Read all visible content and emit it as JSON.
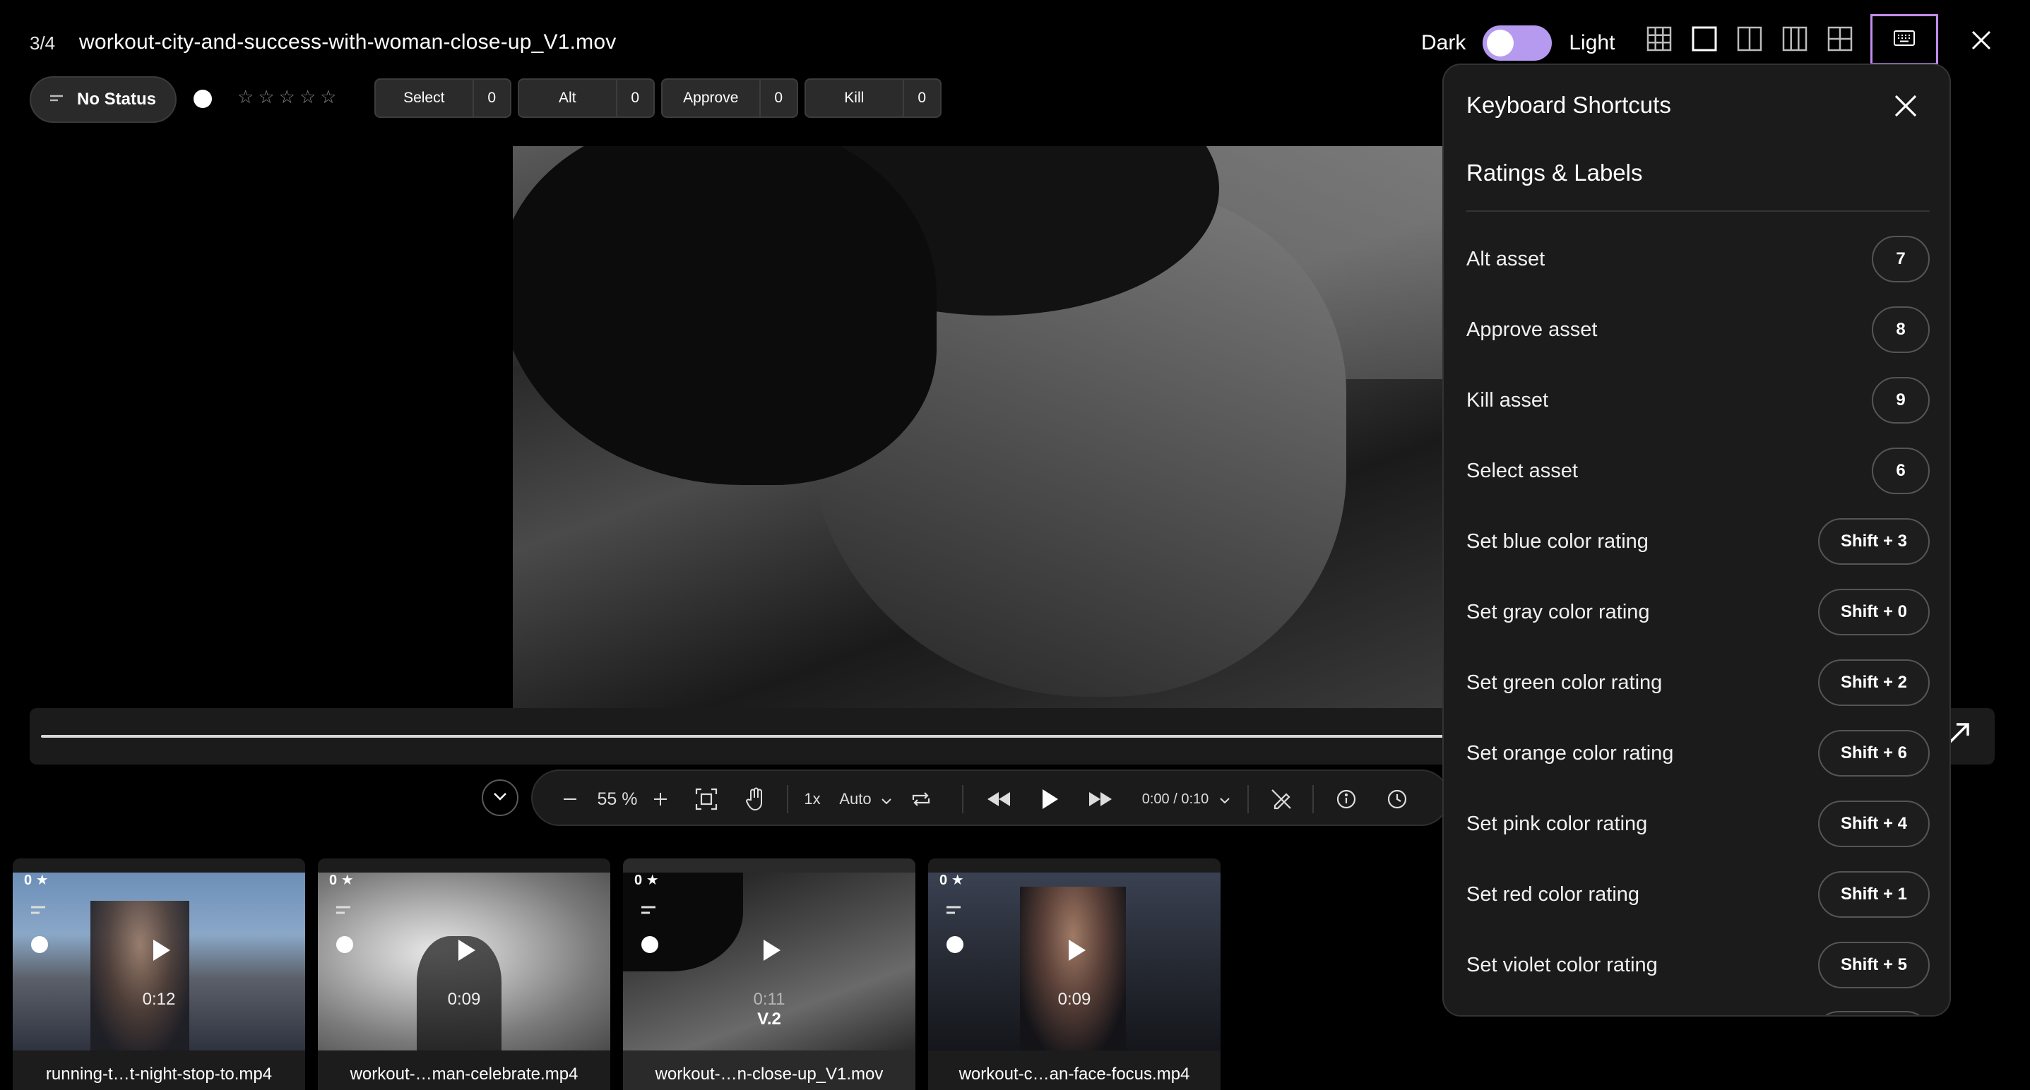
{
  "header": {
    "counter": "3/4",
    "filename": "workout-city-and-success-with-woman-close-up_V1.mov",
    "theme_dark": "Dark",
    "theme_light": "Light"
  },
  "status_bar": {
    "status_label": "No Status",
    "star_rating": 0,
    "labels": [
      {
        "name": "Select",
        "count": "0"
      },
      {
        "name": "Alt",
        "count": "0"
      },
      {
        "name": "Approve",
        "count": "0"
      },
      {
        "name": "Kill",
        "count": "0"
      }
    ]
  },
  "player": {
    "zoom": "55 %",
    "speed": "1x",
    "quality": "Auto",
    "time": "0:00 / 0:10"
  },
  "thumbnails": [
    {
      "rating": "0",
      "duration": "0:12",
      "version": "",
      "name": "running-t…t-night-stop-to.mp4"
    },
    {
      "rating": "0",
      "duration": "0:09",
      "version": "",
      "name": "workout-…man-celebrate.mp4"
    },
    {
      "rating": "0",
      "duration": "0:11",
      "version": "V.2",
      "name": "workout-…n-close-up_V1.mov"
    },
    {
      "rating": "0",
      "duration": "0:09",
      "version": "",
      "name": "workout-c…an-face-focus.mp4"
    }
  ],
  "shortcuts_panel": {
    "title": "Keyboard Shortcuts",
    "section": "Ratings & Labels",
    "rows": [
      {
        "label": "Alt asset",
        "key": "7"
      },
      {
        "label": "Approve asset",
        "key": "8"
      },
      {
        "label": "Kill asset",
        "key": "9"
      },
      {
        "label": "Select asset",
        "key": "6"
      },
      {
        "label": "Set blue color rating",
        "key": "Shift + 3"
      },
      {
        "label": "Set gray color rating",
        "key": "Shift + 0"
      },
      {
        "label": "Set green color rating",
        "key": "Shift + 2"
      },
      {
        "label": "Set orange color rating",
        "key": "Shift + 6"
      },
      {
        "label": "Set pink color rating",
        "key": "Shift + 4"
      },
      {
        "label": "Set red color rating",
        "key": "Shift + 1"
      },
      {
        "label": "Set violet color rating",
        "key": "Shift + 5"
      }
    ]
  },
  "colors": {
    "accent": "#c28cf0",
    "toggle": "#b59af0"
  }
}
